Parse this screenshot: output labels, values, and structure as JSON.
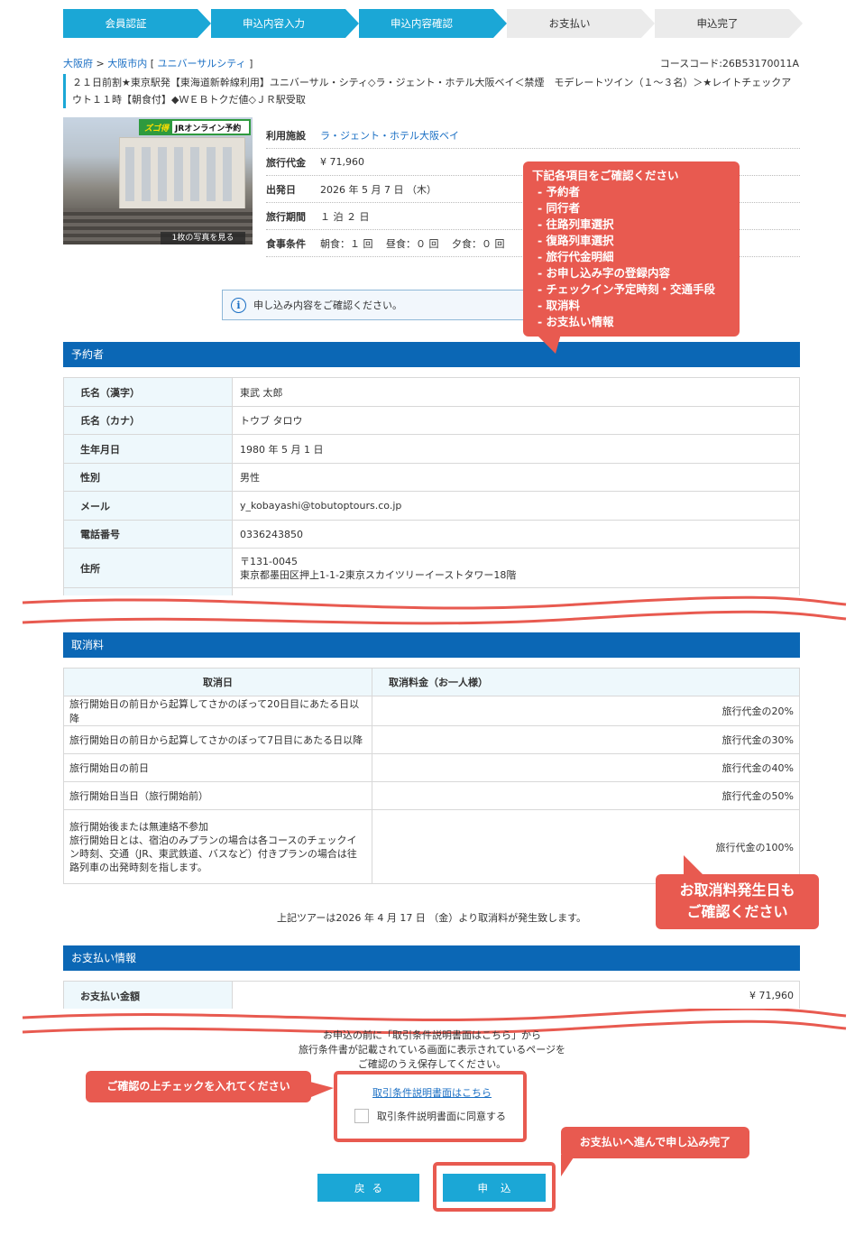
{
  "steps": [
    "会員認証",
    "申込内容入力",
    "申込内容確認",
    "お支払い",
    "申込完了"
  ],
  "breadcrumb": {
    "pref": "大阪府",
    "sep": " > ",
    "city": "大阪市内",
    "area_prefix": " [ ",
    "area": "ユニバーサルシティ",
    "area_suffix": " ]"
  },
  "course_code": "コースコード:26B53170011A",
  "tour_title": "２１日前割★東京駅発【東海道新幹線利用】ユニバーサル・シティ◇ラ・ジェント・ホテル大阪ベイ＜禁煙　モデレートツイン（１～３名）＞★レイトチェックアウト１１時【朝食付】◆ＷＥＢトクだ値◇ＪＲ駅受取",
  "photo": {
    "badge_left": "ズゴ得",
    "badge_right": "JRオンライン予約",
    "caption": "1枚の写真を見る"
  },
  "info": [
    {
      "label": "利用施設",
      "value": "ラ・ジェント・ホテル大阪ベイ"
    },
    {
      "label": "旅行代金",
      "value": "¥ 71,960"
    },
    {
      "label": "出発日",
      "value": "2026 年 5 月 7 日 （木）"
    },
    {
      "label": "旅行期間",
      "value": "１ 泊 ２ 日"
    },
    {
      "label": "食事条件",
      "value": "朝食：１ 回　 昼食：０ 回　 夕食：０ 回"
    }
  ],
  "notice": {
    "icon": "info-icon",
    "text": "申し込み内容をご確認ください。"
  },
  "sections": {
    "applicant": "予約者",
    "cancel": "取消料",
    "payment": "お支払い情報"
  },
  "applicant": [
    {
      "label": "氏名（漢字）",
      "value": "東武 太郎"
    },
    {
      "label": "氏名（カナ）",
      "value": "トウブ タロウ"
    },
    {
      "label": "生年月日",
      "value": "1980 年 5 月 1 日"
    },
    {
      "label": "性別",
      "value": "男性"
    },
    {
      "label": "メール",
      "value": "y_kobayashi@tobutoptours.co.jp"
    },
    {
      "label": "電話番号",
      "value": "0336243850"
    },
    {
      "label": "住所",
      "value": "〒131-0045",
      "value2": "東京都墨田区押上1-1-2東京スカイツリーイーストタワー18階"
    }
  ],
  "cancel_table": {
    "headers": [
      "取消日",
      "取消料金（お一人様）"
    ],
    "rows": [
      {
        "day": "旅行開始日の前日から起算してさかのぼって20日目にあたる日以降",
        "fee": "旅行代金の20%"
      },
      {
        "day": "旅行開始日の前日から起算してさかのぼって7日目にあたる日以降",
        "fee": "旅行代金の30%"
      },
      {
        "day": "旅行開始日の前日",
        "fee": "旅行代金の40%"
      },
      {
        "day": "旅行開始日当日（旅行開始前）",
        "fee": "旅行代金の50%"
      }
    ],
    "last_row": {
      "line1": "旅行開始後または無連絡不参加",
      "line2": "旅行開始日とは、宿泊のみプランの場合は各コースのチェックイン時刻、交通（JR、東武鉄道、バスなど）付きプランの場合は往路列車の出発時刻を指します。",
      "fee": "旅行代金の100%"
    },
    "note": "上記ツアーは2026 年 4 月 17 日 （金）より取消料が発生致します。"
  },
  "payment": {
    "label": "お支払い金額",
    "value": "¥ 71,960"
  },
  "terms": {
    "line1": "お申込の前に「取引条件説明書面はこちら」から",
    "line2": "旅行条件書が記載されている画面に表示されているページを",
    "line3": "ご確認のうえ保存してください。",
    "link": "取引条件説明書面はこちら",
    "agree_label": "取引条件説明書面に同意する"
  },
  "buttons": {
    "back": "戻る",
    "apply": "申込"
  },
  "annotations": {
    "main_title": "下記各項目をご確認ください",
    "main_items": [
      "- 予約者",
      "- 同行者",
      "- 往路列車選択",
      "- 復路列車選択",
      "- 旅行代金明細",
      "- お申し込み字の登録内容",
      "- チェックイン予定時刻・交通手段",
      "- 取消料",
      "- お支払い情報"
    ],
    "cancel_line1": "お取消料発生日も",
    "cancel_line2": "ご確認ください",
    "check": "ご確認の上チェックを入れてください",
    "pay": "お支払いへ進んで申し込み完了"
  },
  "colors": {
    "step_active": "#1ba7d6",
    "step_inactive": "#ebebeb",
    "section_bar": "#0b67b5",
    "callout": "#e85a50",
    "link": "#1a6fc4"
  }
}
